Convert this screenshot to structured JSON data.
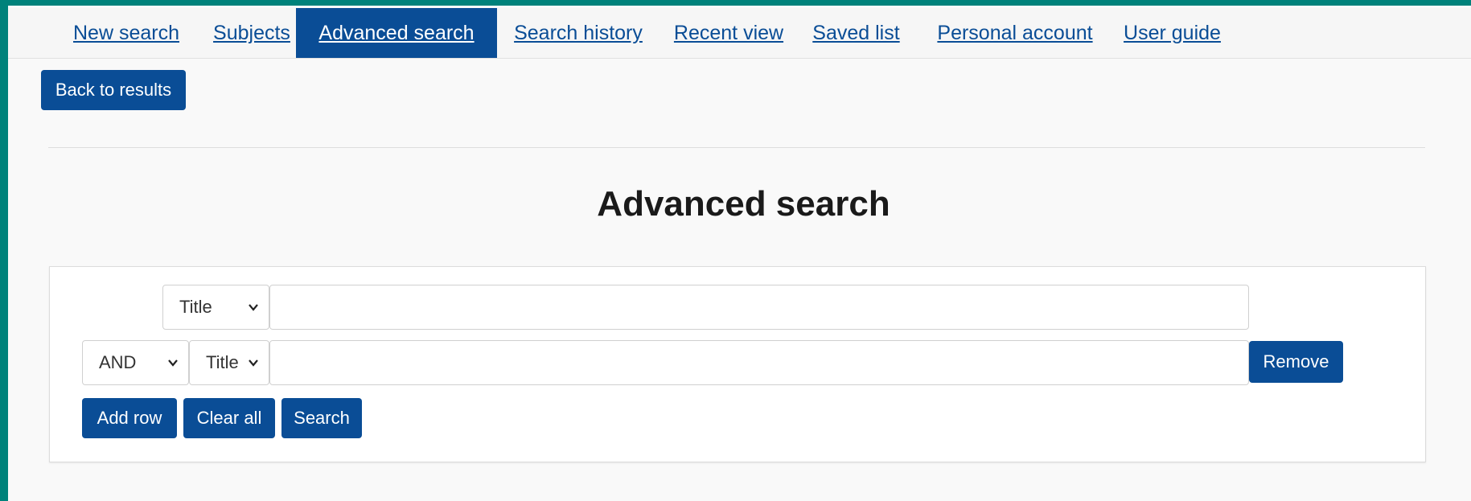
{
  "nav": {
    "items": [
      {
        "label": "New search",
        "active": false
      },
      {
        "label": "Subjects",
        "active": false
      },
      {
        "label": "Advanced search",
        "active": true
      },
      {
        "label": "Search history",
        "active": false
      },
      {
        "label": "Recent view",
        "active": false
      },
      {
        "label": "Saved list",
        "active": false
      },
      {
        "label": "Personal account",
        "active": false
      },
      {
        "label": "User guide",
        "active": false
      }
    ]
  },
  "back_button": "Back to results",
  "page_title": "Advanced search",
  "rows": [
    {
      "field": "Title",
      "value": ""
    },
    {
      "operator": "AND",
      "field": "Title",
      "value": "",
      "remove_label": "Remove"
    }
  ],
  "actions": {
    "add_row": "Add row",
    "clear_all": "Clear all",
    "search": "Search"
  },
  "colors": {
    "accent": "#0a4d96",
    "frame": "#00827b"
  },
  "icons": {
    "select_chevron": "chevron-down-icon"
  }
}
